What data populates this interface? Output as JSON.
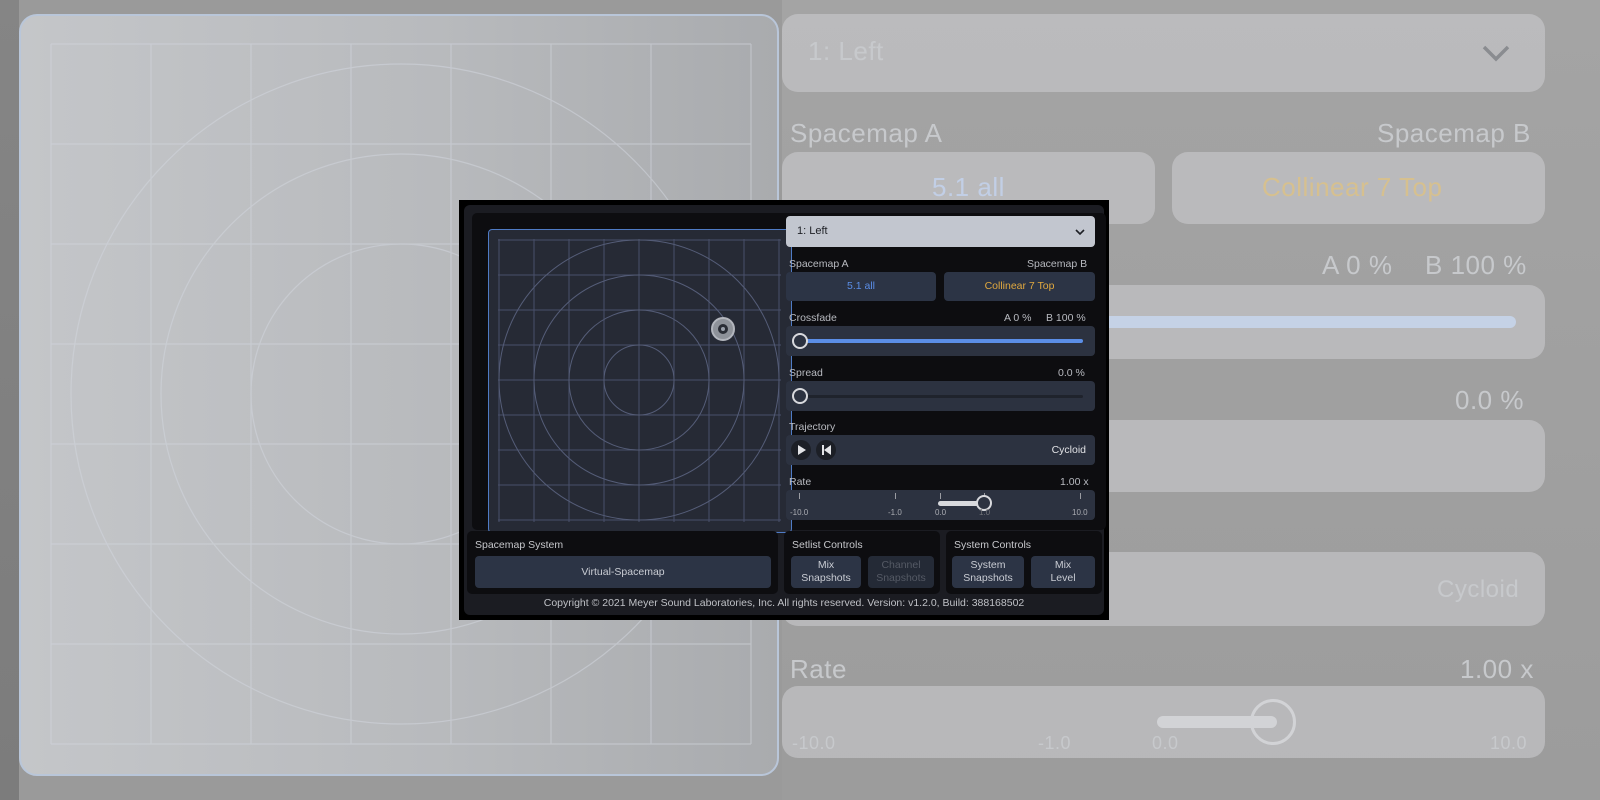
{
  "header": {
    "channel_selected": "1: Left",
    "chevron_icon": "chevron-down-icon"
  },
  "spacemap": {
    "label_a": "Spacemap A",
    "label_b": "Spacemap B",
    "value_a": "5.1 all",
    "value_b": "Collinear 7 Top",
    "color_a": "#5b8ee6",
    "color_b": "#e0a83f"
  },
  "crossfade": {
    "label": "Crossfade",
    "value_a": "A 0 %",
    "value_b": "B 100 %",
    "level": 0
  },
  "spread": {
    "label": "Spread",
    "value": "0.0 %",
    "level": 0
  },
  "trajectory": {
    "label": "Trajectory",
    "play_icon": "play-icon",
    "rewind_icon": "skip-back-icon",
    "value": "Cycloid"
  },
  "rate": {
    "label": "Rate",
    "value": "1.00 x",
    "ticks": [
      "-10.0",
      "-1.0",
      "0.0",
      "1.0",
      "10.0"
    ]
  },
  "system_panel": {
    "title": "Spacemap System",
    "button": "Virtual-Spacemap"
  },
  "setlist_panel": {
    "title": "Setlist Controls",
    "mix_snapshots_1": "Mix",
    "mix_snapshots_2": "Snapshots",
    "channel_snapshots_1": "Channel",
    "channel_snapshots_2": "Snapshots"
  },
  "system_controls": {
    "title": "System Controls",
    "system_snapshots_1": "System",
    "system_snapshots_2": "Snapshots",
    "mix_level_1": "Mix",
    "mix_level_2": "Level"
  },
  "footer": {
    "text": "Copyright © 2021 Meyer Sound Laboratories, Inc. All rights reserved. Version: v1.2.0, Build: 388168502"
  },
  "colors": {
    "accent": "#5b8ee6",
    "gold": "#e0a83f",
    "pad_border": "#4f7bc5"
  }
}
